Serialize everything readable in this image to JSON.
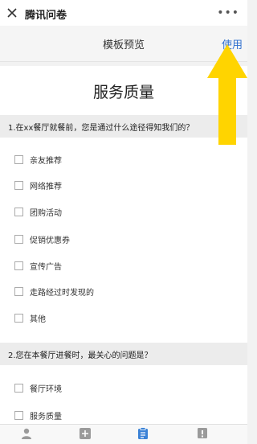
{
  "app": {
    "title": "腾讯问卷"
  },
  "nav": {
    "title": "模板预览",
    "use_label": "使用"
  },
  "survey": {
    "title": "服务质量",
    "questions": [
      {
        "text": "1.在xx餐厅就餐前，您是通过什么途径得知我们的？",
        "options": [
          "亲友推荐",
          "网络推荐",
          "团购活动",
          "促销优惠券",
          "宣传广告",
          "走路经过时发现的",
          "其他"
        ]
      },
      {
        "text": "2.您在本餐厅进餐时，最关心的问题是？",
        "options": [
          "餐厅环境",
          "服务质量"
        ]
      }
    ]
  },
  "colors": {
    "accent": "#2f6fcf",
    "arrow": "#ffd400",
    "active_tab": "#3b82d6"
  },
  "bottom_tabs": [
    "person-icon",
    "add-icon",
    "clipboard-icon",
    "flag-icon"
  ]
}
